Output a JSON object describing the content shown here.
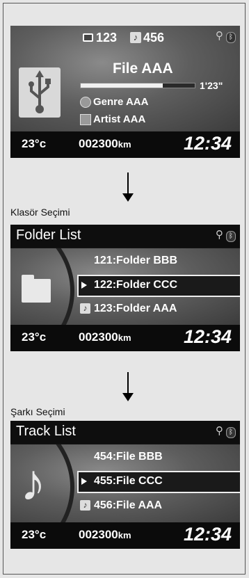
{
  "panel1": {
    "folder_num": "123",
    "track_num": "456",
    "file_name": "File AAA",
    "time": "1'23\"",
    "genre": "Genre AAA",
    "artist": "Artist AAA",
    "progress": 0.72
  },
  "status": {
    "temp": "23°c",
    "odo_value": "002300",
    "odo_unit": "km",
    "clock": "12:34"
  },
  "caption1": "Klasör Seçimi",
  "panel2": {
    "title": "Folder List",
    "items": [
      "121:Folder BBB",
      "122:Folder CCC",
      "123:Folder AAA"
    ]
  },
  "caption2": "Şarkı Seçimi",
  "panel3": {
    "title": "Track List",
    "items": [
      "454:File BBB",
      "455:File CCC",
      "456:File AAA"
    ]
  }
}
